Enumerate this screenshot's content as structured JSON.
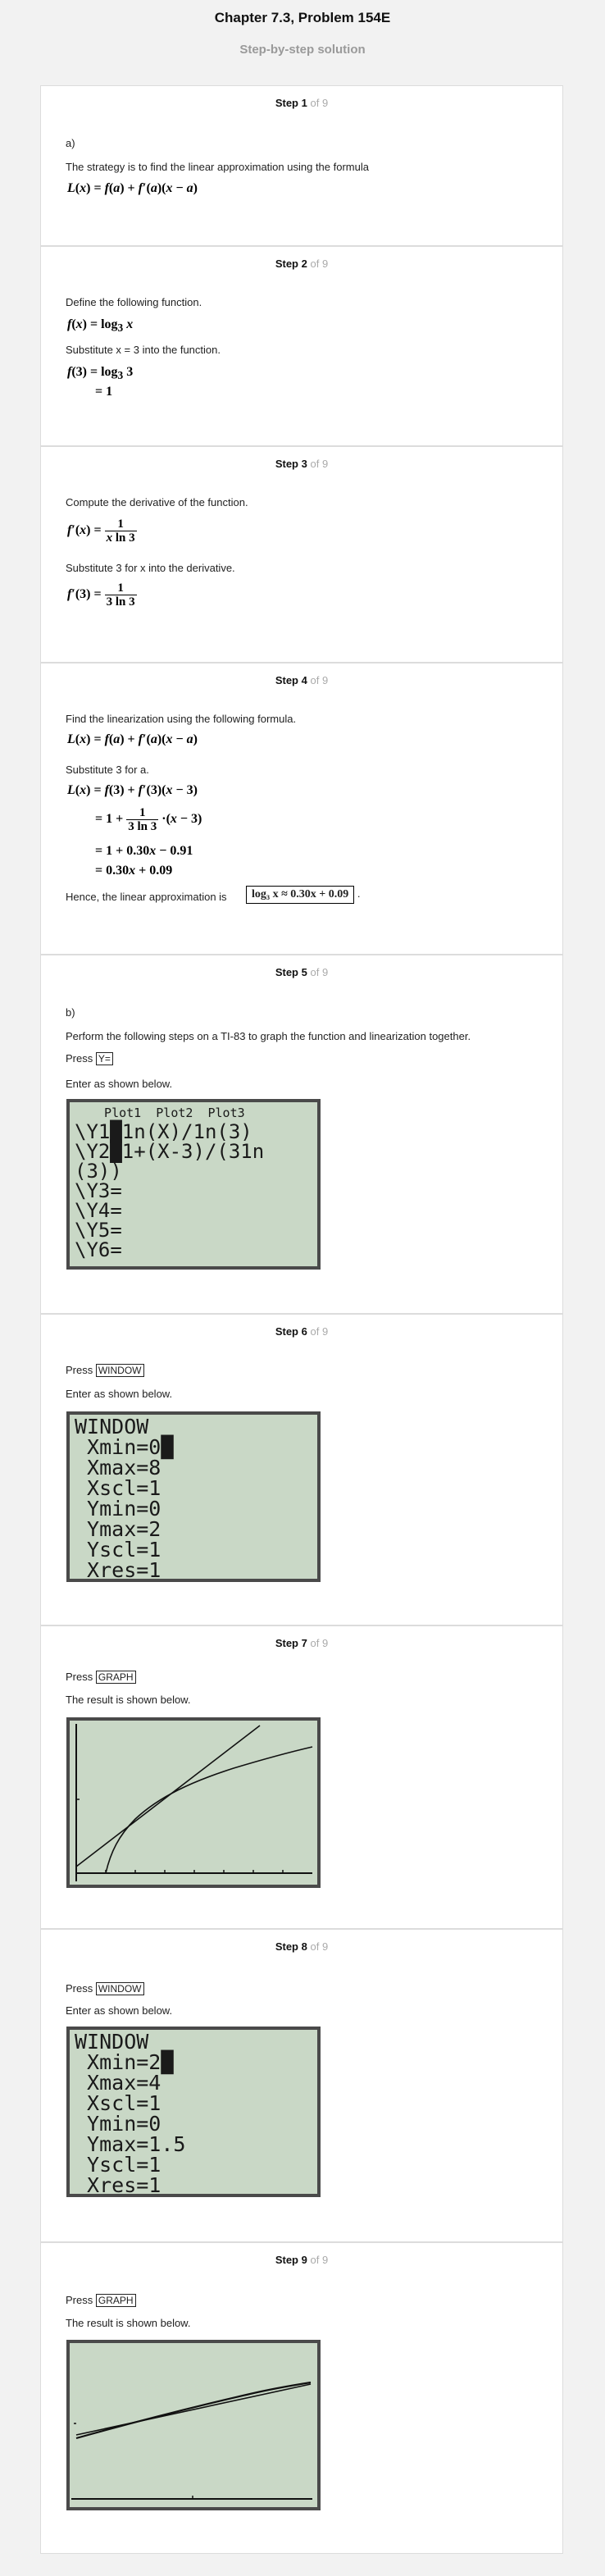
{
  "header": {
    "title": "Chapter 7.3, Problem 154E",
    "subtitle": "Step-by-step solution"
  },
  "step_word": "Step",
  "of_total": "of 9",
  "steps": [
    {
      "num": "1",
      "part": "a)",
      "text1": "The strategy is to find the linear approximation using the formula"
    },
    {
      "num": "2",
      "text1": "Define the following function.",
      "text2": "Substitute x = 3 into the function."
    },
    {
      "num": "3",
      "text1": "Compute the derivative of the function.",
      "text2": "Substitute 3 for x into the derivative."
    },
    {
      "num": "4",
      "text1": "Find the linearization using the following formula.",
      "text2": "Substitute 3 for a.",
      "text3": "Hence, the linear approximation is",
      "answer": "log₃ x ≈ 0.30x + 0.09"
    },
    {
      "num": "5",
      "part": "b)",
      "text1": "Perform the following steps on a TI-83 to graph the function and linearization together.",
      "press": "Press",
      "key": "Y=",
      "text2": "Enter as shown below.",
      "screen": [
        "  Plot1  Plot2  Plot3",
        "\\Y1█1n(X)/1n(3)",
        "\\Y2█1+(X-3)/(31n",
        "(3))",
        "\\Y3=",
        "\\Y4=",
        "\\Y5=",
        "\\Y6="
      ]
    },
    {
      "num": "6",
      "press": "Press",
      "key": "WINDOW",
      "text2": "Enter as shown below.",
      "screen": [
        "WINDOW",
        " Xmin=0█",
        " Xmax=8",
        " Xscl=1",
        " Ymin=0",
        " Ymax=2",
        " Yscl=1",
        " Xres=1"
      ]
    },
    {
      "num": "7",
      "press": "Press",
      "key": "GRAPH",
      "text2": "The result is shown below."
    },
    {
      "num": "8",
      "press": "Press",
      "key": "WINDOW",
      "text2": "Enter as shown below.",
      "screen": [
        "WINDOW",
        " Xmin=2█",
        " Xmax=4",
        " Xscl=1",
        " Ymin=0",
        " Ymax=1.5",
        " Yscl=1",
        " Xres=1"
      ]
    },
    {
      "num": "9",
      "press": "Press",
      "key": "GRAPH",
      "text2": "The result is shown below."
    }
  ]
}
